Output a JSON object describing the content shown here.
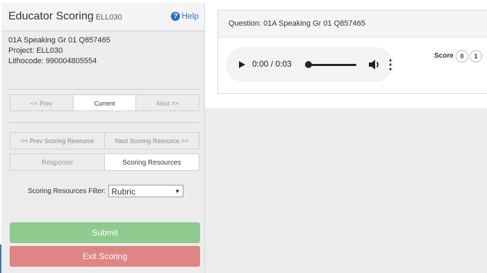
{
  "sidebar": {
    "title": "Educator Scoring",
    "code": "ELL030",
    "help_label": "Help",
    "info": {
      "item": "01A Speaking Gr 01 Q857465",
      "project": "Project: ELL030",
      "lithocode": "Lithocode: 990004805554"
    },
    "nav": {
      "prev": "<< Prev",
      "current": "Current",
      "next": "Next >>"
    },
    "resource_nav": {
      "prev": "<< Prev Scoring Resource",
      "next": "Next Scoring Resource >>"
    },
    "view_tabs": {
      "response": "Response",
      "resources": "Scoring Resources"
    },
    "filter": {
      "label": "Scoring Resources Filter:",
      "value": "Rubric"
    },
    "submit_label": "Submit",
    "exit_label": "Exit Scoring"
  },
  "question": {
    "title": "Question: 01A Speaking Gr 01 Q857465",
    "player": {
      "time": "0:00 / 0:03"
    },
    "score_label": "Score",
    "score_options": [
      "0",
      "1"
    ]
  },
  "colors": {
    "submit": "#8fcb8f",
    "exit": "#e08585",
    "help": "#2a6fc9"
  }
}
